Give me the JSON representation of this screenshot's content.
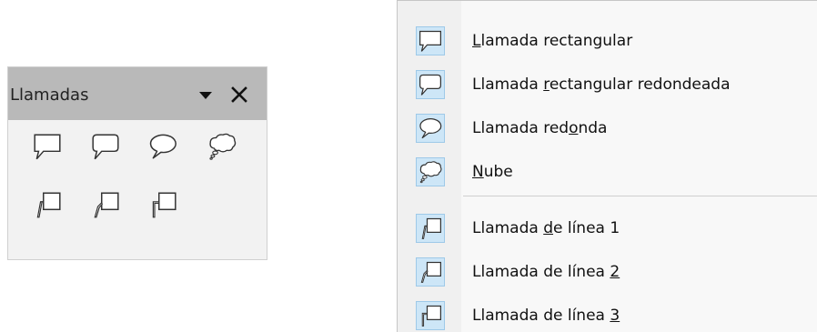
{
  "toolbar": {
    "title": "Llamadas",
    "menu_icon": "triangle-down-icon",
    "close_icon": "close-icon",
    "buttons": [
      {
        "icon": "rectangular-callout-icon"
      },
      {
        "icon": "rounded-rectangular-callout-icon"
      },
      {
        "icon": "round-callout-icon"
      },
      {
        "icon": "cloud-callout-icon"
      },
      {
        "icon": "line-callout-1-icon"
      },
      {
        "icon": "line-callout-2-icon"
      },
      {
        "icon": "line-callout-3-icon"
      }
    ]
  },
  "menu": {
    "items": [
      {
        "pre": "",
        "key": "L",
        "post": "lamada rectangular",
        "icon": "rectangular-callout-icon"
      },
      {
        "pre": "Llamada ",
        "key": "r",
        "post": "ectangular redondeada",
        "icon": "rounded-rectangular-callout-icon"
      },
      {
        "pre": "Llamada red",
        "key": "o",
        "post": "nda",
        "icon": "round-callout-icon"
      },
      {
        "pre": "",
        "key": "N",
        "post": "ube",
        "icon": "cloud-callout-icon"
      },
      {
        "pre": "Llamada ",
        "key": "d",
        "post": "e línea 1",
        "icon": "line-callout-1-icon"
      },
      {
        "pre": "Llamada de línea ",
        "key": "2",
        "post": "",
        "icon": "line-callout-2-icon"
      },
      {
        "pre": "Llamada de línea ",
        "key": "3",
        "post": "",
        "icon": "line-callout-3-icon"
      }
    ]
  },
  "colors": {
    "toolbar_header": "#b9b9b9",
    "icon_highlight": "#cde6f7",
    "icon_highlight_border": "#9ec9e8"
  }
}
